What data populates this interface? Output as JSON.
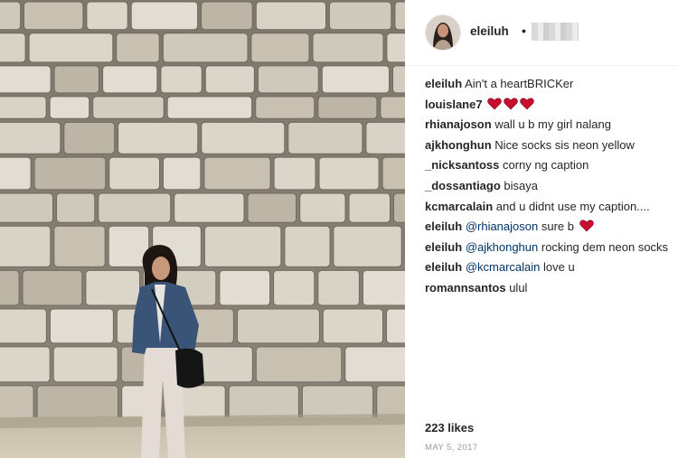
{
  "post": {
    "author": "eleiluh",
    "separator": "•",
    "likes": "223 likes",
    "date": "MAY 5, 2017"
  },
  "icons": {
    "heart_color": "#c8102e",
    "heart": "heart-icon"
  },
  "comments": [
    {
      "author": "eleiluh",
      "text": "Ain't a heartBRICKer"
    },
    {
      "author": "louislane7",
      "text": ""
    },
    {
      "author": "rhianajoson",
      "text": "wall u b my girl nalang"
    },
    {
      "author": "ajkhonghun",
      "text": "Nice socks sis neon yellow"
    },
    {
      "author": "_nicksantoss",
      "text": "corny ng caption"
    },
    {
      "author": "_dossantiago",
      "text": "bisaya"
    },
    {
      "author": "kcmarcalain",
      "text": "and u didnt use my caption...."
    },
    {
      "author": "eleiluh",
      "mention": "@rhianajoson",
      "text": "sure b"
    },
    {
      "author": "eleiluh",
      "mention": "@ajkhonghun",
      "text": "rocking dem neon socks"
    },
    {
      "author": "eleiluh",
      "mention": "@kcmarcalain",
      "text": "love u"
    },
    {
      "author": "romannsantos",
      "text": "ulul"
    }
  ]
}
